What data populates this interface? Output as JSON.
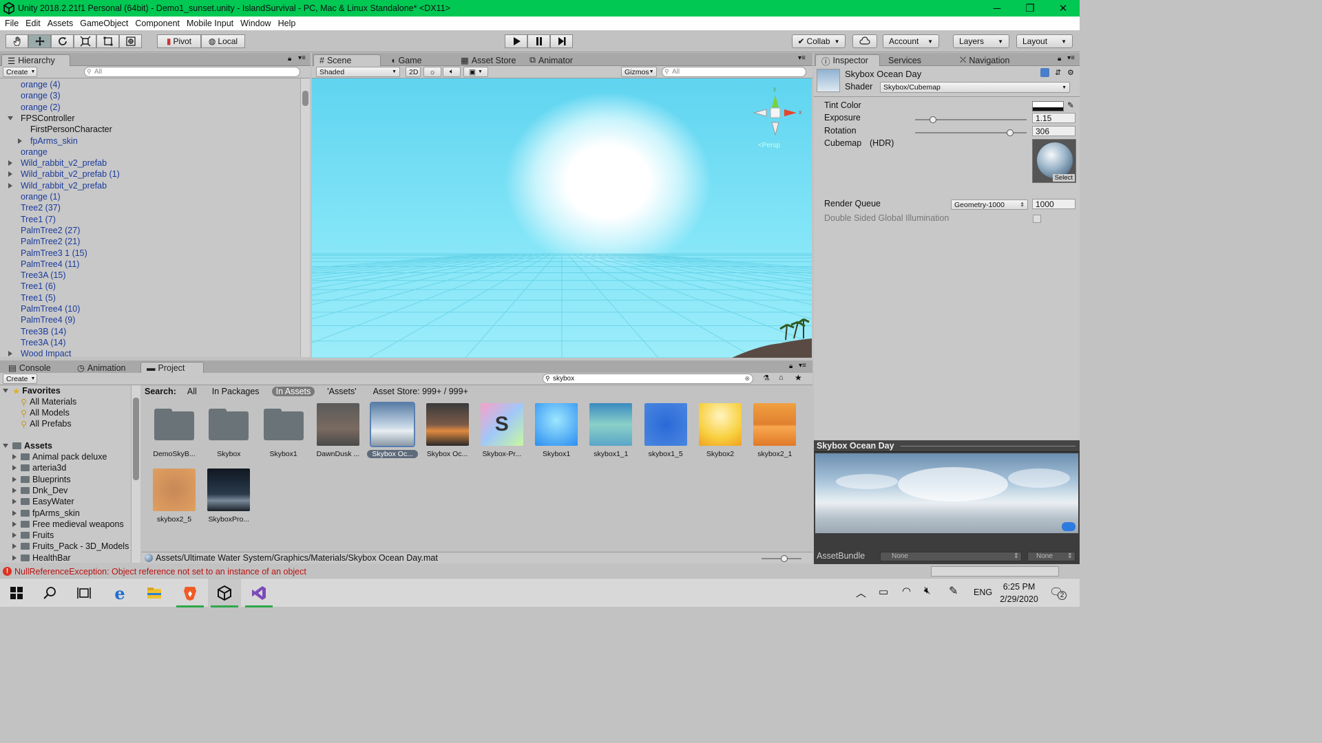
{
  "window": {
    "title": "Unity 2018.2.21f1 Personal (64bit) - Demo1_sunset.unity - IslandSurvival - PC, Mac & Linux Standalone* <DX11>",
    "minimize": "─",
    "restore": "❐",
    "close": "✕"
  },
  "menu": [
    "File",
    "Edit",
    "Assets",
    "GameObject",
    "Component",
    "Mobile Input",
    "Window",
    "Help"
  ],
  "toolbar": {
    "pivot": "Pivot",
    "local": "Local",
    "collab": "Collab",
    "account": "Account",
    "layers": "Layers",
    "layout": "Layout"
  },
  "hierarchy": {
    "tab": "Hierarchy",
    "create": "Create",
    "search_placeholder": "All",
    "items": [
      {
        "label": "orange (4)",
        "indent": 0,
        "arrow": "",
        "color": "blue"
      },
      {
        "label": "orange (3)",
        "indent": 0,
        "arrow": "",
        "color": "blue"
      },
      {
        "label": "orange (2)",
        "indent": 0,
        "arrow": "",
        "color": "blue"
      },
      {
        "label": "FPSController",
        "indent": 0,
        "arrow": "down",
        "color": "black"
      },
      {
        "label": "FirstPersonCharacter",
        "indent": 1,
        "arrow": "",
        "color": "black"
      },
      {
        "label": "fpArms_skin",
        "indent": 1,
        "arrow": "right",
        "color": "blue"
      },
      {
        "label": "orange",
        "indent": 0,
        "arrow": "",
        "color": "blue"
      },
      {
        "label": "Wild_rabbit_v2_prefab",
        "indent": 0,
        "arrow": "right",
        "color": "blue"
      },
      {
        "label": "Wild_rabbit_v2_prefab (1)",
        "indent": 0,
        "arrow": "right",
        "color": "blue"
      },
      {
        "label": "Wild_rabbit_v2_prefab",
        "indent": 0,
        "arrow": "right",
        "color": "blue"
      },
      {
        "label": "orange (1)",
        "indent": 0,
        "arrow": "",
        "color": "blue"
      },
      {
        "label": "Tree2 (37)",
        "indent": 0,
        "arrow": "",
        "color": "blue"
      },
      {
        "label": "Tree1 (7)",
        "indent": 0,
        "arrow": "",
        "color": "blue"
      },
      {
        "label": "PalmTree2 (27)",
        "indent": 0,
        "arrow": "",
        "color": "blue"
      },
      {
        "label": "PalmTree2 (21)",
        "indent": 0,
        "arrow": "",
        "color": "blue"
      },
      {
        "label": "PalmTree3 1 (15)",
        "indent": 0,
        "arrow": "",
        "color": "blue"
      },
      {
        "label": "PalmTree4 (11)",
        "indent": 0,
        "arrow": "",
        "color": "blue"
      },
      {
        "label": "Tree3A (15)",
        "indent": 0,
        "arrow": "",
        "color": "blue"
      },
      {
        "label": "Tree1 (6)",
        "indent": 0,
        "arrow": "",
        "color": "blue"
      },
      {
        "label": "Tree1 (5)",
        "indent": 0,
        "arrow": "",
        "color": "blue"
      },
      {
        "label": "PalmTree4 (10)",
        "indent": 0,
        "arrow": "",
        "color": "blue"
      },
      {
        "label": "PalmTree4 (9)",
        "indent": 0,
        "arrow": "",
        "color": "blue"
      },
      {
        "label": "Tree3B (14)",
        "indent": 0,
        "arrow": "",
        "color": "blue"
      },
      {
        "label": "Tree3A (14)",
        "indent": 0,
        "arrow": "",
        "color": "blue"
      },
      {
        "label": "Wood Impact",
        "indent": 0,
        "arrow": "right",
        "color": "blue"
      }
    ]
  },
  "scene": {
    "tabs": [
      "Scene",
      "Game",
      "Asset Store",
      "Animator"
    ],
    "shading": "Shaded",
    "mode_2d": "2D",
    "gizmos": "Gizmos",
    "search_placeholder": "All",
    "persp": "<Persp",
    "gizmo_y": "y",
    "gizmo_x": "x"
  },
  "inspector": {
    "tabs": [
      "Inspector",
      "Services",
      "Navigation"
    ],
    "material_name": "Skybox Ocean Day",
    "shader_label": "Shader",
    "shader_value": "Skybox/Cubemap",
    "tint_label": "Tint Color",
    "exposure_label": "Exposure",
    "exposure_value": "1.15",
    "exposure_fraction": 0.16,
    "rotation_label": "Rotation",
    "rotation_value": "306",
    "rotation_fraction": 0.85,
    "cubemap_label": "Cubemap",
    "hdr_label": "(HDR)",
    "select_label": "Select",
    "render_queue_label": "Render Queue",
    "render_queue_option": "Geometry-1000",
    "render_queue_value": "1000",
    "dsgi_label": "Double Sided Global Illumination",
    "preview_title": "Skybox Ocean Day",
    "assetbundle_label": "AssetBundle",
    "assetbundle_value": "None",
    "assetbundle_variant": "None"
  },
  "bottom": {
    "tabs": [
      "Console",
      "Animation",
      "Project"
    ],
    "create": "Create",
    "search_value": "skybox",
    "search_bar": {
      "label": "Search:",
      "options": [
        "All",
        "In Packages",
        "In Assets",
        "'Assets'",
        "Asset Store: 999+ / 999+"
      ],
      "active": "In Assets"
    },
    "favorites": {
      "title": "Favorites",
      "items": [
        "All Materials",
        "All Models",
        "All Prefabs"
      ]
    },
    "assets_root": "Assets",
    "asset_folders": [
      "Animal pack deluxe",
      "arteria3d",
      "Blueprints",
      "Dnk_Dev",
      "EasyWater",
      "fpArms_skin",
      "Free medieval weapons",
      "Fruits",
      "Fruits_Pack - 3D_Models",
      "HealthBar"
    ],
    "results": [
      {
        "label": "DemoSkyB...",
        "kind": "folder"
      },
      {
        "label": "Skybox",
        "kind": "folder"
      },
      {
        "label": "Skybox1",
        "kind": "folder"
      },
      {
        "label": "DawnDusk ...",
        "kind": "dawn"
      },
      {
        "label": "Skybox Oc...",
        "kind": "ocean",
        "selected": true
      },
      {
        "label": "Skybox Oc...",
        "kind": "sunset"
      },
      {
        "label": "Skybox-Pr...",
        "kind": "shader"
      },
      {
        "label": "Skybox1",
        "kind": "blue-light"
      },
      {
        "label": "skybox1_1",
        "kind": "teal"
      },
      {
        "label": "skybox1_5",
        "kind": "blue-dark"
      },
      {
        "label": "Skybox2",
        "kind": "yellow"
      },
      {
        "label": "skybox2_1",
        "kind": "orange"
      },
      {
        "label": "skybox2_5",
        "kind": "tan"
      },
      {
        "label": "SkyboxPro...",
        "kind": "night"
      }
    ],
    "path": "Assets/Ultimate Water System/Graphics/Materials/Skybox Ocean Day.mat"
  },
  "status": {
    "error": "NullReferenceException: Object reference not set to an instance of an object"
  },
  "taskbar": {
    "lang": "ENG",
    "time": "6:25 PM",
    "date": "2/29/2020",
    "notif_count": "2"
  },
  "colors": {
    "titlebar": "#00c853",
    "link_blue": "#1a3a9a",
    "sky": "#6fe0f5"
  }
}
